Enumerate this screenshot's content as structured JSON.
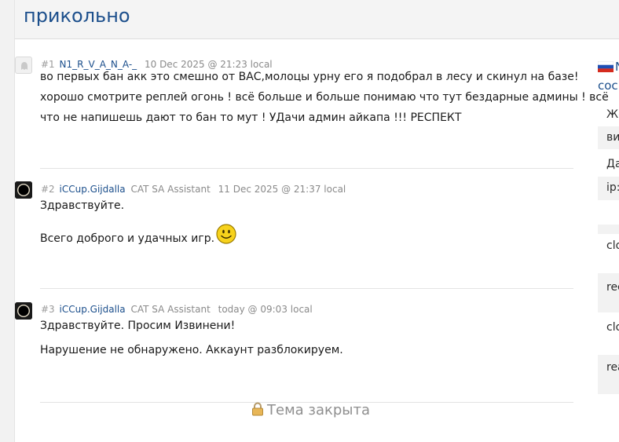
{
  "header": {
    "title": "прикольно"
  },
  "posts": [
    {
      "number": "#1",
      "author": "N1_R_V_A_N_A-_",
      "rank": "",
      "date": "10 Dec 2025 @ 21:23 local",
      "lines": [
        "во первых бан акк это смешно от ВАС,молоцы урну его я подобрал в лесу и скинул на базе!",
        "хорошо смотрите реплей огонь ! всё больше и больше понимаю что тут бездарные админы ! всё",
        "что не напишешь дают то бан то мут ! УДачи админ айкапа !!! РЕСПЕКТ"
      ]
    },
    {
      "number": "#2",
      "author": "iCCup.Gijdalla",
      "rank": "CAT SA Assistant",
      "date": "11 Dec 2025 @ 21:37 local",
      "greeting": "Здравствуйте.",
      "farewell": "Всего доброго и удачных игр."
    },
    {
      "number": "#3",
      "author": "iCCup.Gijdalla",
      "rank": "CAT SA Assistant",
      "date": "today @ 09:03 local",
      "greeting": "Здравствуйте. Просим Извинени!",
      "message": "Нарушение не обнаружено. Аккаунт разблокируем."
    }
  ],
  "footer": {
    "locked_label": "Тема закрыта"
  },
  "sidebar": {
    "link_fragment": "N",
    "link_fragment2": "сос",
    "rows": [
      "Же",
      "ви",
      "Да",
      "ip:",
      "",
      "clo",
      "rec",
      "clo",
      "rea"
    ]
  },
  "colors": {
    "link": "#1c4f8c",
    "muted": "#8a8a8a",
    "smiley": "#f7d21c"
  },
  "icons": {
    "avatar1": "ghost-avatar-icon",
    "avatar23": "eclipse-avatar-icon",
    "smiley": "smiley-icon",
    "lock": "lock-icon",
    "flag": "russia-flag-icon"
  }
}
